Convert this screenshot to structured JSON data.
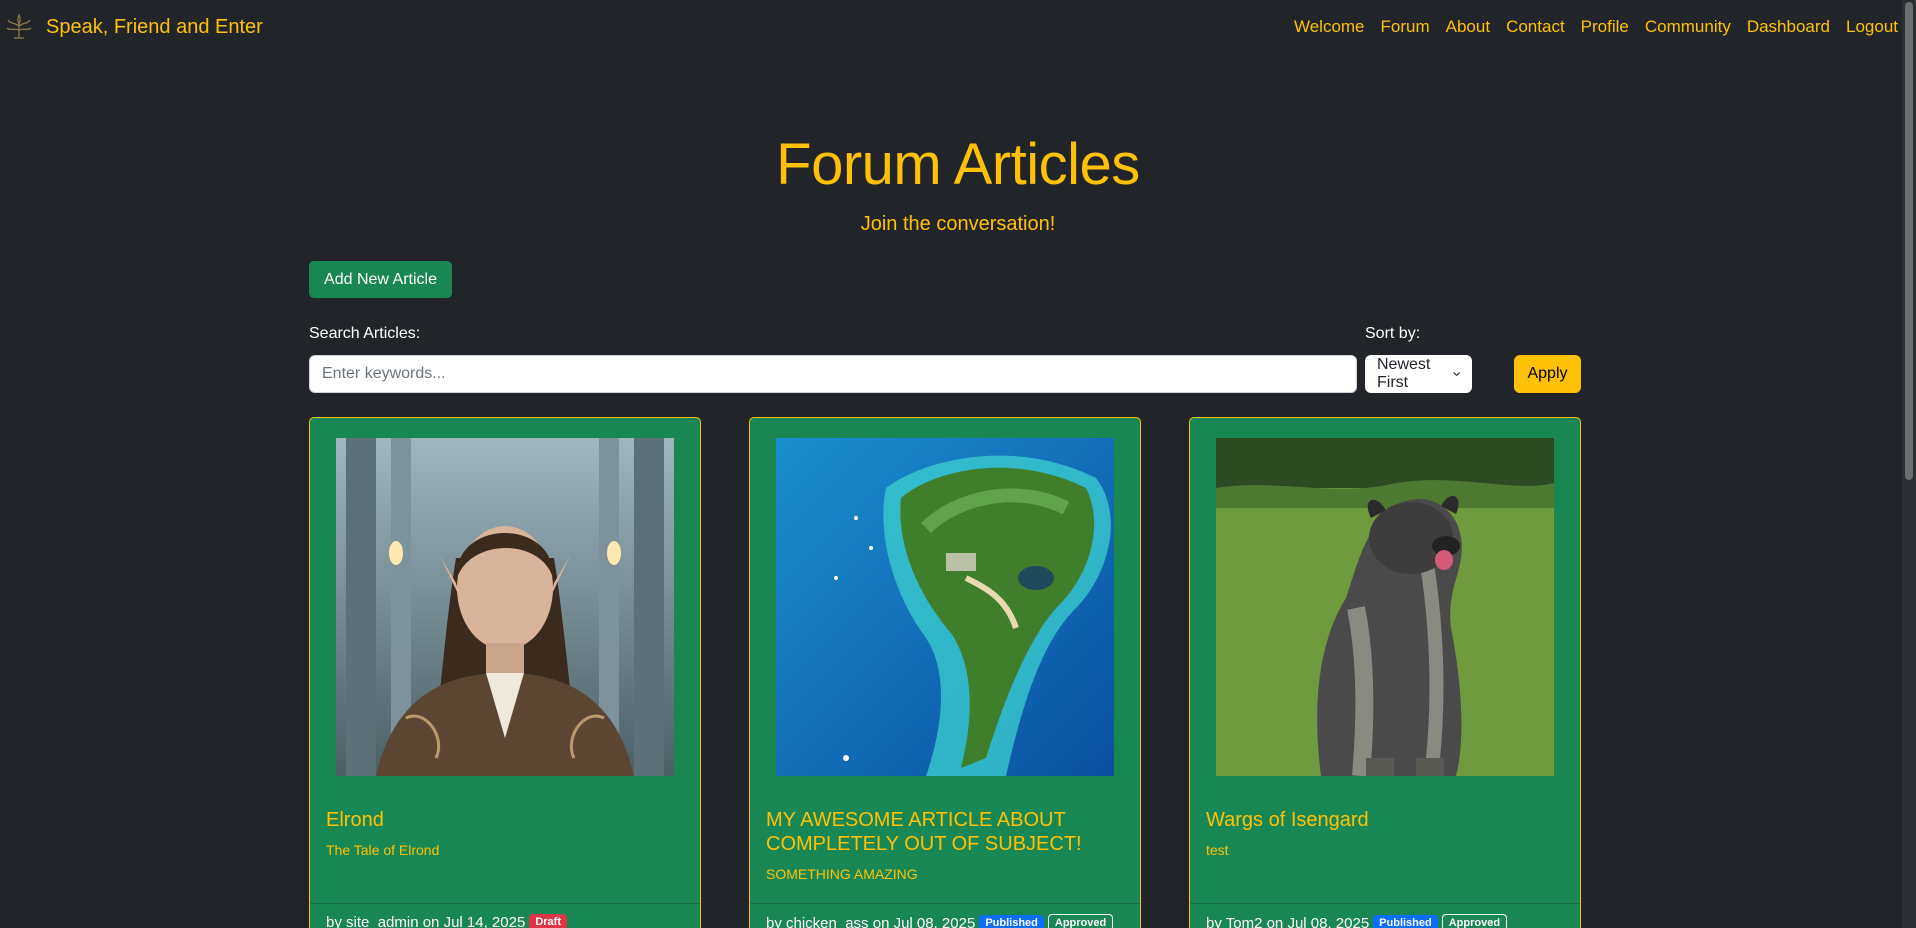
{
  "nav": {
    "brand": "Speak, Friend and Enter",
    "links": [
      "Welcome",
      "Forum",
      "About",
      "Contact",
      "Profile",
      "Community",
      "Dashboard",
      "Logout"
    ]
  },
  "hero": {
    "title": "Forum Articles",
    "subtitle": "Join the conversation!"
  },
  "actions": {
    "add_label": "Add New Article"
  },
  "search": {
    "label": "Search Articles:",
    "placeholder": "Enter keywords...",
    "value": ""
  },
  "sort": {
    "label": "Sort by:",
    "selected": "Newest First",
    "apply_label": "Apply"
  },
  "articles": [
    {
      "title": "Elrond",
      "subtitle": "The Tale of Elrond",
      "byline": "by site_admin on Jul 14, 2025",
      "badges": [
        "Draft"
      ]
    },
    {
      "title": "MY AWESOME ARTICLE ABOUT COMPLETELY OUT OF SUBJECT!",
      "subtitle": "SOMETHING AMAZING",
      "byline": "by chicken_ass on Jul 08, 2025",
      "badges": [
        "Published",
        "Approved"
      ]
    },
    {
      "title": "Wargs of Isengard",
      "subtitle": "test",
      "byline": "by Tom2 on Jul 08, 2025",
      "badges": [
        "Published",
        "Approved"
      ]
    }
  ],
  "colors": {
    "background": "#212529",
    "accent": "#ffc107",
    "card": "#198754",
    "draft": "#dc3545",
    "published": "#0d6efd"
  }
}
